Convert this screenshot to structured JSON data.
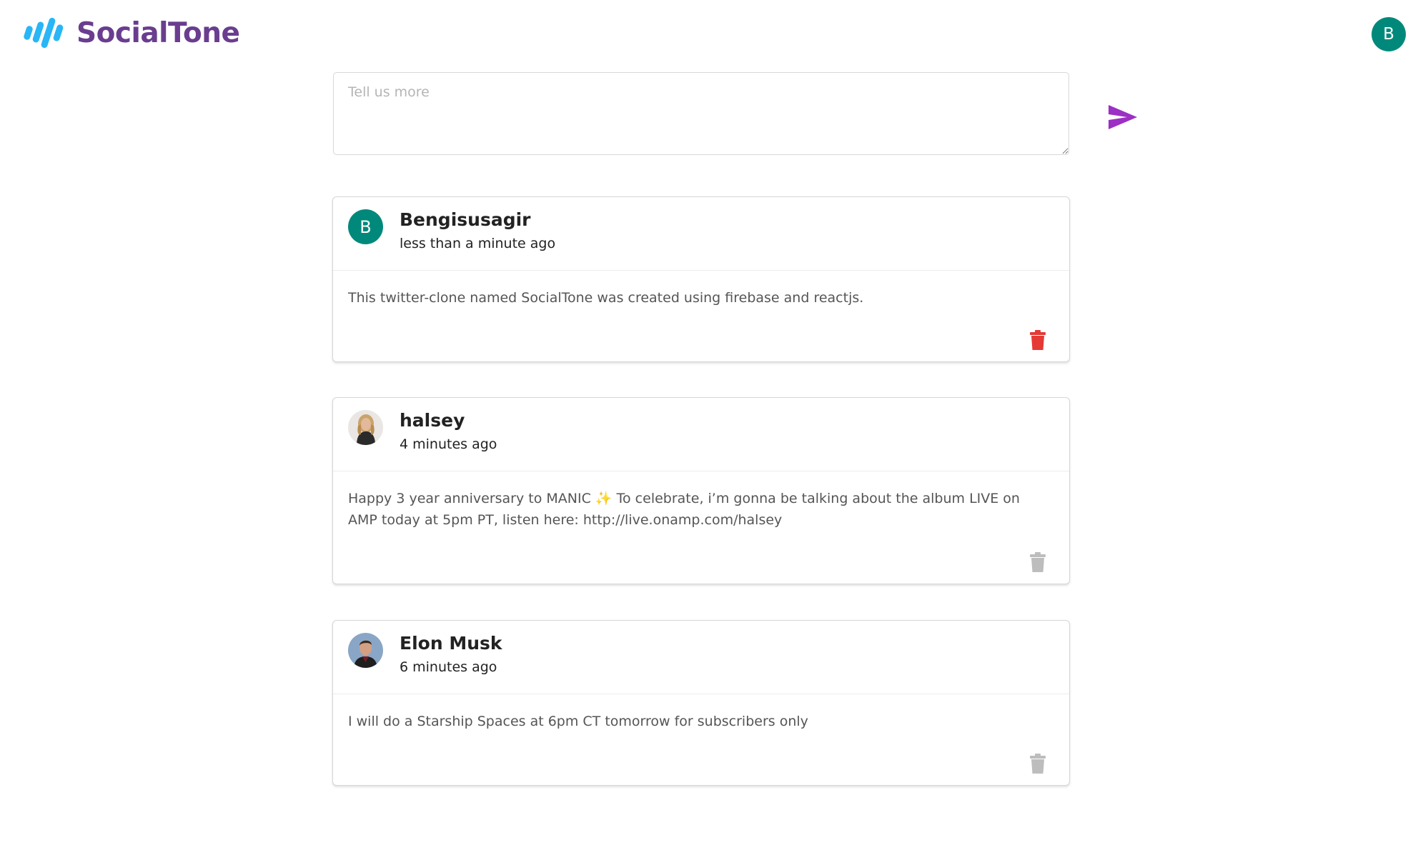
{
  "app": {
    "name": "SocialTone",
    "user_initial": "B"
  },
  "composer": {
    "placeholder": "Tell us more"
  },
  "colors": {
    "brand": "#6a3d8f",
    "logo_accent": "#29b6f6",
    "send": "#9c2fc4",
    "avatar": "#00897b",
    "delete_active": "#e53935",
    "delete_inactive": "#bdbdbd"
  },
  "posts": [
    {
      "author": "Bengisusagir",
      "avatar_initial": "B",
      "time": "less than a minute ago",
      "text": "This twitter-clone named SocialTone was created using firebase and reactjs.",
      "delete_icon": "trash-icon"
    },
    {
      "author": "halsey",
      "time": "4 minutes ago",
      "text_before": "Happy 3 year anniversary to MANIC",
      "text_emoji": "✨",
      "text_after": "To celebrate, i’m gonna be talking about the album LIVE on AMP today at 5pm PT, listen here: http://live.onamp.com/halsey",
      "delete_icon": "trash-icon"
    },
    {
      "author": "Elon Musk",
      "time": "6 minutes ago",
      "text": "I will do a Starship Spaces at 6pm CT tomorrow for subscribers only",
      "delete_icon": "trash-icon"
    }
  ]
}
